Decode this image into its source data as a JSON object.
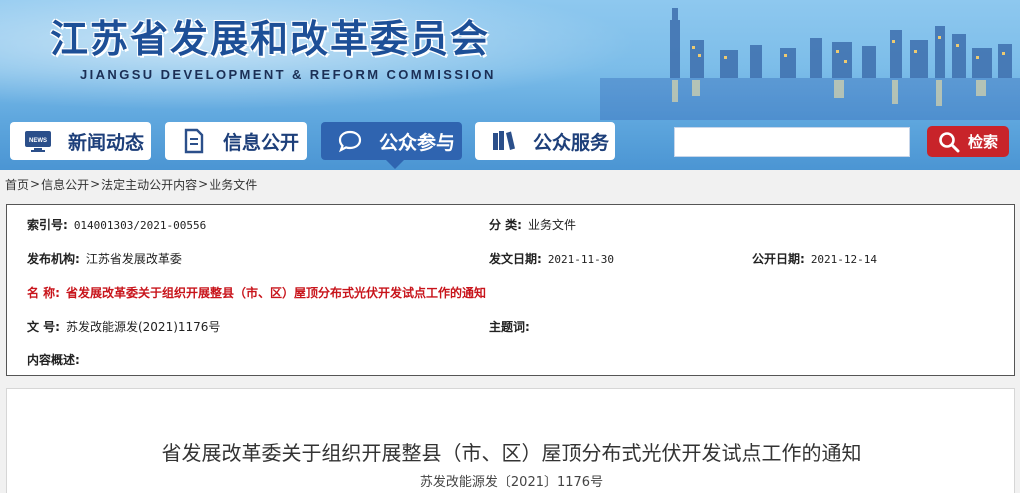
{
  "header": {
    "title": "江苏省发展和改革委员会",
    "subtitle": "JIANGSU DEVELOPMENT & REFORM COMMISSION"
  },
  "nav": {
    "items": [
      {
        "label": "新闻动态",
        "icon": "news-icon"
      },
      {
        "label": "信息公开",
        "icon": "document-icon"
      },
      {
        "label": "公众参与",
        "icon": "chat-bubble-icon",
        "active": true
      },
      {
        "label": "公众服务",
        "icon": "book-icon"
      }
    ],
    "search": {
      "placeholder": "",
      "button_label": "检索",
      "icon": "search-icon"
    },
    "colors": {
      "active": "#2f64b0",
      "search_button": "#c8242a"
    }
  },
  "breadcrumb": [
    "首页",
    "信息公开",
    "法定主动公开内容",
    "业务文件"
  ],
  "breadcrumb_separator": ">",
  "meta": {
    "index_no": {
      "label": "索引号:",
      "value": "014001303/2021-00556"
    },
    "category": {
      "label": "分  类:",
      "value": "业务文件"
    },
    "publisher": {
      "label": "发布机构:",
      "value": "江苏省发展改革委"
    },
    "issue_date": {
      "label": "发文日期:",
      "value": "2021-11-30"
    },
    "publish_date": {
      "label": "公开日期:",
      "value": "2021-12-14"
    },
    "name": {
      "label": "名  称:",
      "value": "省发展改革委关于组织开展整县（市、区）屋顶分布式光伏开发试点工作的通知"
    },
    "doc_no": {
      "label": "文  号:",
      "value": "苏发改能源发(2021)1176号"
    },
    "keywords": {
      "label": "主题词:",
      "value": ""
    },
    "summary": {
      "label": "内容概述:",
      "value": ""
    }
  },
  "article": {
    "title": "省发展改革委关于组织开展整县（市、区）屋顶分布式光伏开发试点工作的通知",
    "doc_no": "苏发改能源发〔2021〕1176号"
  }
}
